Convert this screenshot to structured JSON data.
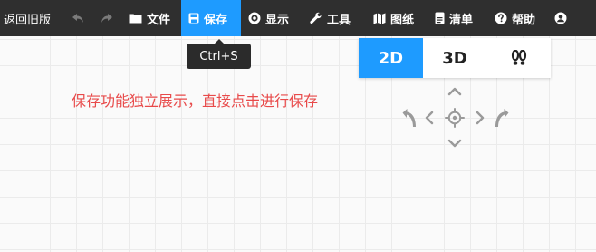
{
  "toolbar": {
    "back_label": "返回旧版",
    "undo_icon": "undo-icon",
    "redo_icon": "redo-icon",
    "file_label": "文件",
    "save_label": "保存",
    "show_label": "显示",
    "tools_label": "工具",
    "drawings_label": "图纸",
    "list_label": "清单",
    "help_label": "帮助",
    "user_icon": "user-icon"
  },
  "tooltip": {
    "text": "Ctrl+S"
  },
  "note": {
    "text": "保存功能独立展示，直接点击进行保存"
  },
  "view_switch": {
    "modes": [
      "2D",
      "3D"
    ],
    "active": "2D",
    "walk_icon": "footprints-icon"
  },
  "colors": {
    "toolbar_bg": "#2f2f2f",
    "accent": "#1e9bff",
    "note_text": "#e84a4a",
    "canvas_bg": "#fafafa",
    "nav_icon": "#9a9a9a"
  }
}
